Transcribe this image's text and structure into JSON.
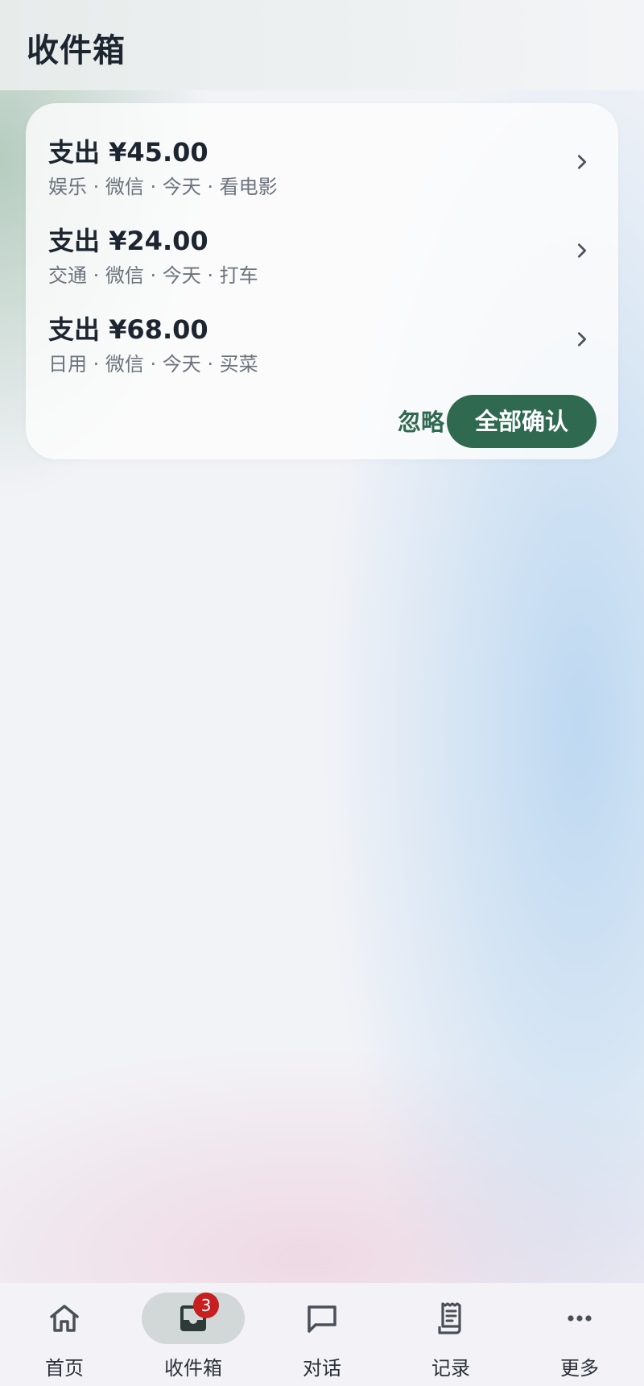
{
  "header": {
    "title": "收件箱"
  },
  "inbox": {
    "items": [
      {
        "title": "支出 ¥45.00",
        "subtitle": "娱乐 · 微信 · 今天 · 看电影"
      },
      {
        "title": "支出 ¥24.00",
        "subtitle": "交通 · 微信 · 今天 · 打车"
      },
      {
        "title": "支出 ¥68.00",
        "subtitle": "日用 · 微信 · 今天 · 买菜"
      }
    ],
    "ignore_label": "忽略",
    "confirm_all_label": "全部确认"
  },
  "nav": {
    "items": [
      {
        "label": "首页",
        "icon": "home-icon"
      },
      {
        "label": "收件箱",
        "icon": "inbox-icon",
        "badge": "3",
        "active": true
      },
      {
        "label": "对话",
        "icon": "chat-bubble-icon"
      },
      {
        "label": "记录",
        "icon": "receipt-icon"
      },
      {
        "label": "更多",
        "icon": "more-horizontal-icon"
      }
    ]
  },
  "colors": {
    "accent": "#2f6a50",
    "badge": "#c71f1f",
    "active_pill": "#d2d7d7",
    "title_text": "#1d2530",
    "secondary_text": "#6b737d"
  }
}
